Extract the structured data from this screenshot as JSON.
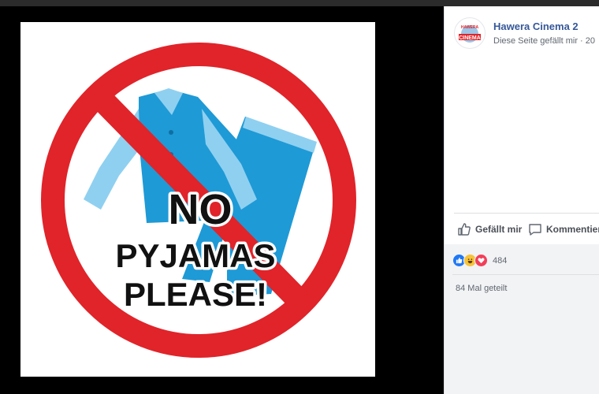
{
  "post": {
    "page_name": "Hawera Cinema 2",
    "page_subtitle": "Diese Seite gefällt mir · 20",
    "avatar_text_top": "HAWERA",
    "avatar_text_main": "CINEMA"
  },
  "image": {
    "line1": "NO",
    "line2": "PYJAMAS",
    "line3": "PLEASE!"
  },
  "actions": {
    "like_label": "Gefällt mir",
    "comment_label": "Kommentieren"
  },
  "stats": {
    "reaction_count": "484",
    "shares_label": "84 Mal geteilt"
  },
  "colors": {
    "link_blue": "#365899",
    "ban_red": "#e0242a",
    "pyjama_blue": "#1e9ad6",
    "pyjama_light": "#8fd0f0"
  }
}
